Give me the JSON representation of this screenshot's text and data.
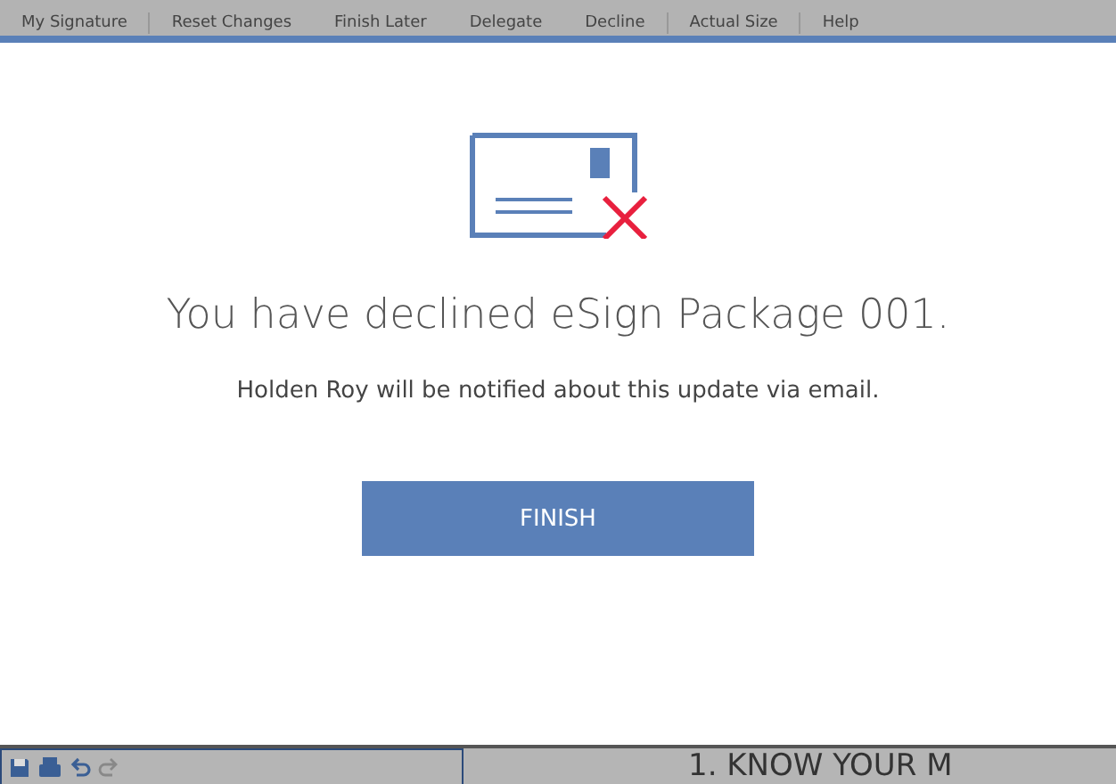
{
  "toolbar": {
    "items": [
      {
        "label": "My Signature"
      },
      {
        "label": "Reset Changes"
      },
      {
        "label": "Finish Later"
      },
      {
        "label": "Delegate"
      },
      {
        "label": "Decline"
      },
      {
        "label": "Actual Size"
      },
      {
        "label": "Help"
      }
    ]
  },
  "dialog": {
    "title": "You have declined eSign Package 001.",
    "message": "Holden Roy will be notified about this update via email.",
    "button": "FINISH"
  },
  "document": {
    "heading": "1. KNOW YOUR M"
  }
}
